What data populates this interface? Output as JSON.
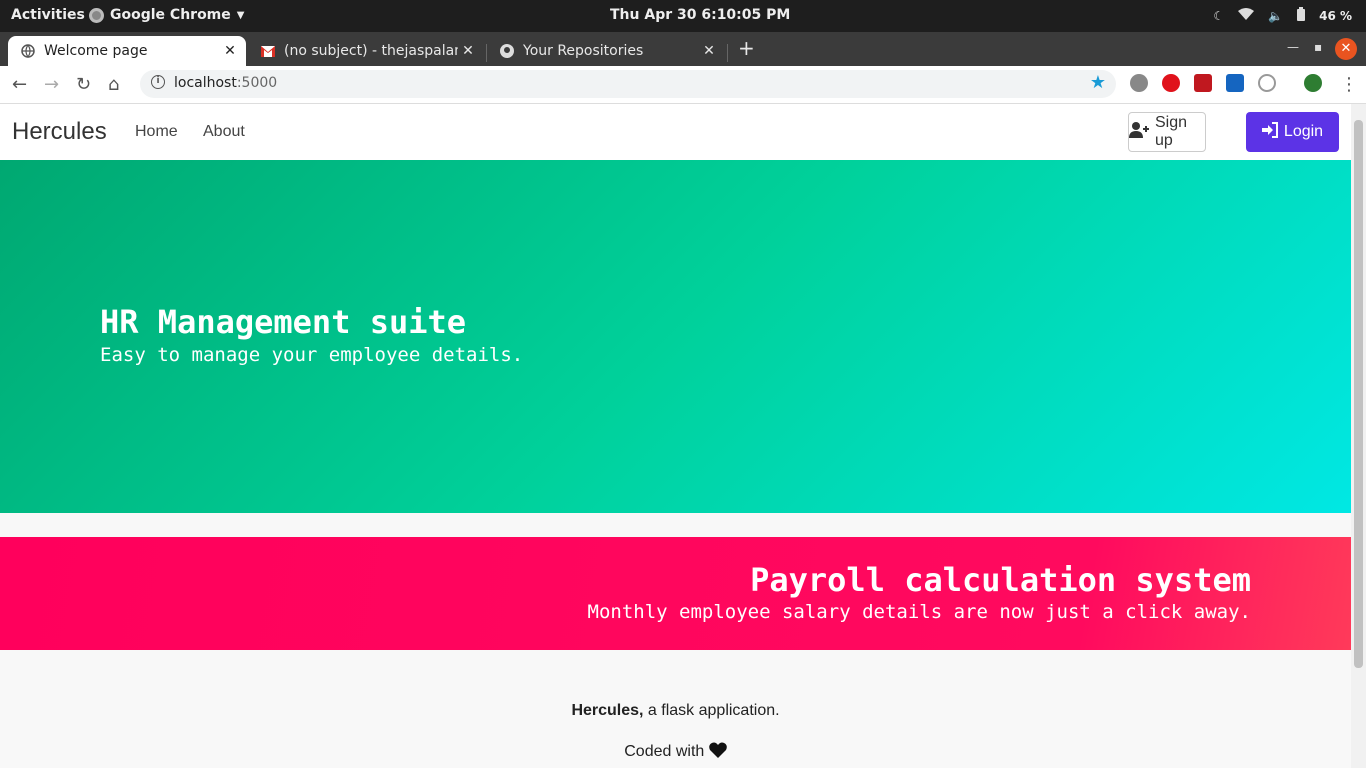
{
  "os_bar": {
    "activities": "Activities",
    "app_name": "Google Chrome",
    "clock": "Thu Apr 30   6:10:05 PM",
    "battery": "46 %"
  },
  "tabs": [
    {
      "title": "Welcome page",
      "active": true
    },
    {
      "title": "(no subject) - thejaspalani",
      "active": false
    },
    {
      "title": "Your Repositories",
      "active": false
    }
  ],
  "address_bar": {
    "host": "localhost",
    "port": ":5000"
  },
  "navbar": {
    "brand": "Hercules",
    "links": [
      "Home",
      "About"
    ],
    "signup_label": "Sign up",
    "login_label": "Login"
  },
  "hero_primary": {
    "heading": "HR Management suite",
    "subheading": "Easy to manage your employee details."
  },
  "hero_secondary": {
    "heading": "Payroll calculation system",
    "subheading": "Monthly employee salary details are now just a click away."
  },
  "footer": {
    "brand": "Hercules,",
    "tagline": " a flask application.",
    "coded_with": "Coded with"
  },
  "colors": {
    "hero_primary_start": "#00a871",
    "hero_primary_end": "#00e8e4",
    "hero_secondary": "#ff005c",
    "login_button": "#5c33e6"
  }
}
